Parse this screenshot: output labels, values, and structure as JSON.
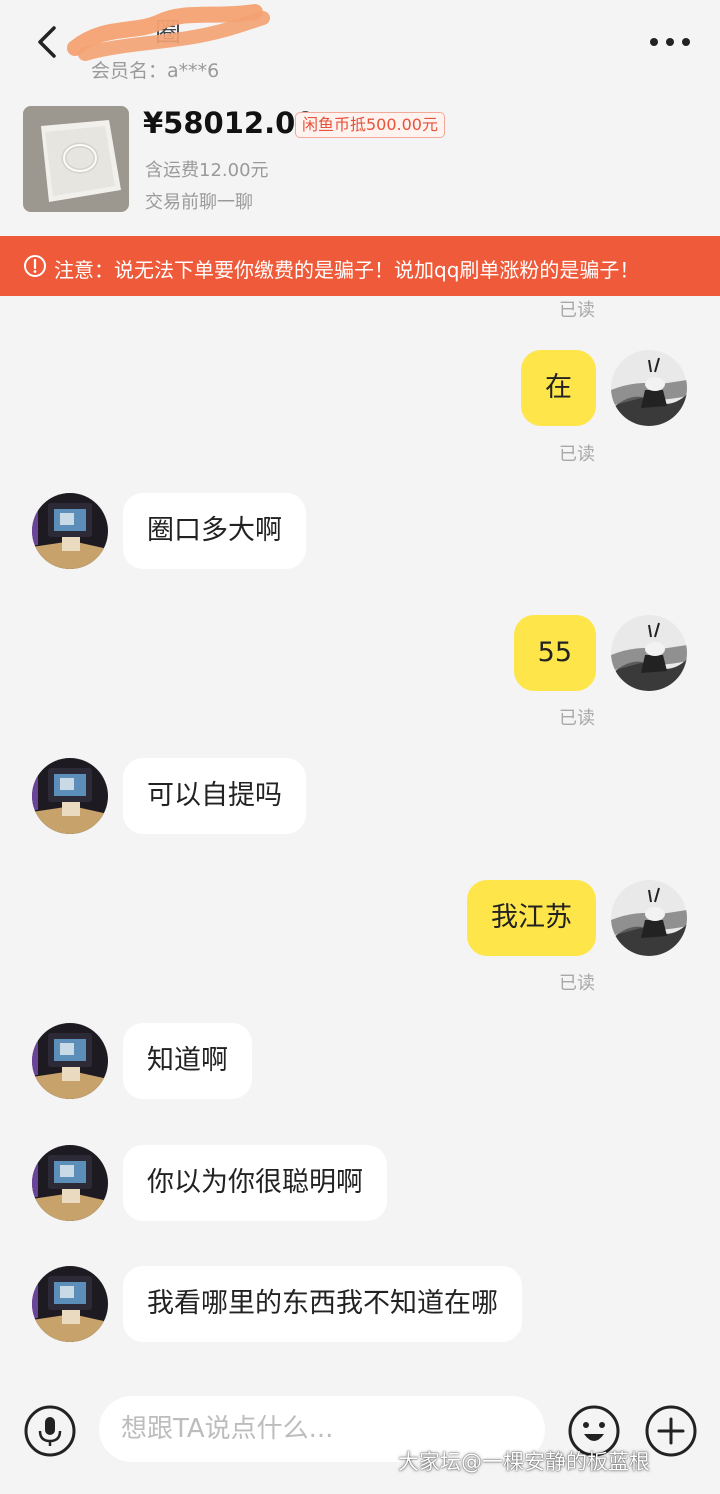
{
  "header": {
    "title_visible_char": "圈",
    "member_label": "会员名：a***6"
  },
  "product": {
    "price": "¥58012.00",
    "coin_tag": "闲鱼币抵500.00元",
    "shipping": "含运费12.00元",
    "chat_prompt": "交易前聊一聊"
  },
  "warning": {
    "text": "注意：说无法下单要你缴费的是骗子！说加qq刷单涨粉的是骗子！"
  },
  "messages": [
    {
      "from": "me",
      "text": "在",
      "status": "已读"
    },
    {
      "from": "them",
      "text": "圈口多大啊"
    },
    {
      "from": "me",
      "text": "55",
      "status": "已读"
    },
    {
      "from": "them",
      "text": "可以自提吗"
    },
    {
      "from": "me",
      "text": "我江苏",
      "status": "已读"
    },
    {
      "from": "them",
      "text": "知道啊"
    },
    {
      "from": "them",
      "text": "你以为你很聪明啊"
    },
    {
      "from": "them",
      "text": "我看哪里的东西我不知道在哪"
    }
  ],
  "top_read_status": "已读",
  "input": {
    "placeholder": "想跟TA说点什么..."
  },
  "watermark": "大家坛@一棵安静的板蓝根",
  "colors": {
    "my_bubble": "#fde54a",
    "their_bubble": "#ffffff",
    "warning_bg": "#ef5a3a",
    "background": "#f4f4f4"
  },
  "icons": [
    "back-arrow-icon",
    "more-dots-icon",
    "warning-circle-icon",
    "microphone-icon",
    "emoji-face-icon",
    "plus-circle-icon"
  ]
}
